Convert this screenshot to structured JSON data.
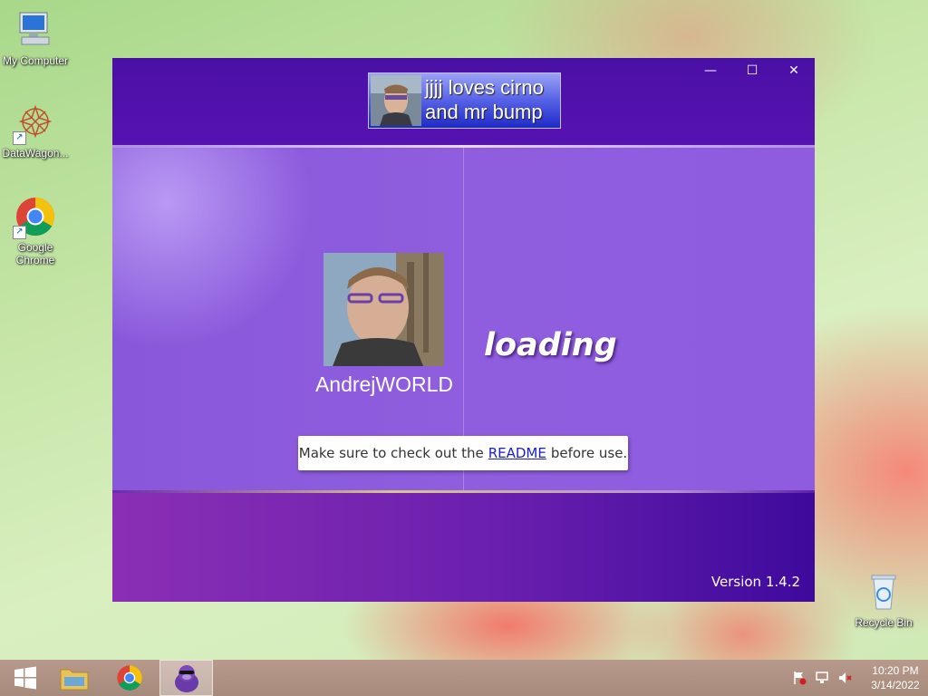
{
  "desktop": {
    "icons": [
      {
        "label": "My Computer"
      },
      {
        "label": "DataWagon..."
      },
      {
        "label": "Google Chrome"
      },
      {
        "label": "Recycle Bin"
      }
    ]
  },
  "window": {
    "controls": {
      "minimize": "—",
      "maximize": "☐",
      "close": "✕"
    },
    "banner": {
      "line1": "jjjj loves cirno",
      "line2": "and mr bump"
    },
    "username": "AndrejWORLD",
    "loading": "loading",
    "notice": {
      "before": "Make sure to check out the",
      "link": "README",
      "after": "before use."
    },
    "version": "Version 1.4.2"
  },
  "taskbar": {
    "clock": {
      "time": "10:20 PM",
      "date": "3/14/2022"
    }
  }
}
